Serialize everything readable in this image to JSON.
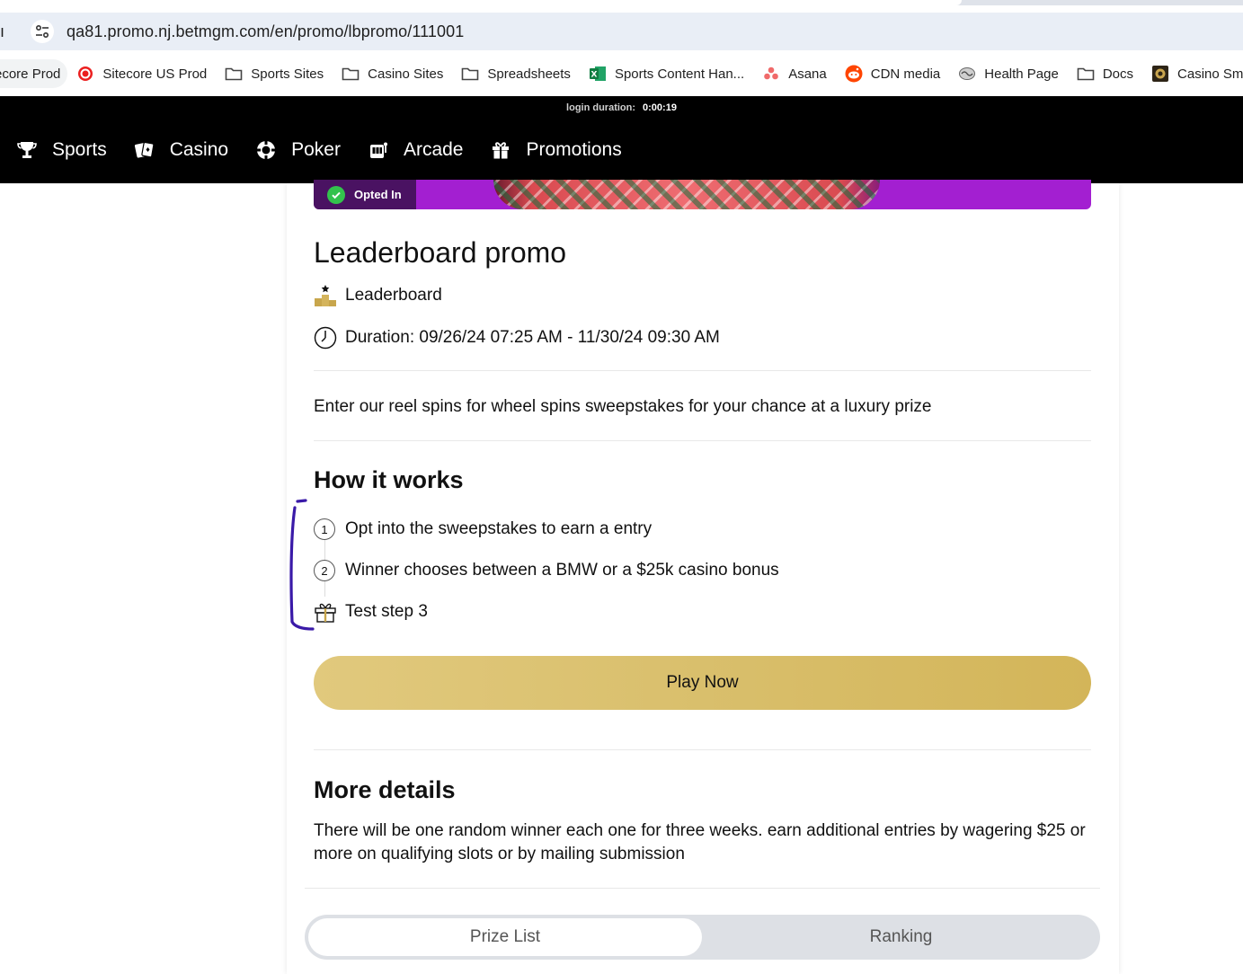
{
  "browser": {
    "left_stub": "ı",
    "url": "qa81.promo.nj.betmgm.com/en/promo/lbpromo/111001",
    "bookmarks": [
      {
        "label": "ecore Prod",
        "icon": "none"
      },
      {
        "label": "Sitecore US Prod",
        "icon": "sitecore-icon"
      },
      {
        "label": "Sports Sites",
        "icon": "folder-icon"
      },
      {
        "label": "Casino Sites",
        "icon": "folder-icon"
      },
      {
        "label": "Spreadsheets",
        "icon": "folder-icon"
      },
      {
        "label": "Sports Content Han...",
        "icon": "excel-icon"
      },
      {
        "label": "Asana",
        "icon": "asana-icon"
      },
      {
        "label": "CDN media",
        "icon": "reddit-icon"
      },
      {
        "label": "Health Page",
        "icon": "health-page-icon"
      },
      {
        "label": "Docs",
        "icon": "folder-icon"
      },
      {
        "label": "Casino Smart",
        "icon": "casino-smart-icon"
      }
    ]
  },
  "header": {
    "login_duration_label": "login duration:",
    "login_duration_value": "0:00:19",
    "nav": [
      {
        "label": "Sports",
        "icon": "trophy-icon"
      },
      {
        "label": "Casino",
        "icon": "cards-icon"
      },
      {
        "label": "Poker",
        "icon": "poker-chip-icon"
      },
      {
        "label": "Arcade",
        "icon": "arcade-icon"
      },
      {
        "label": "Promotions",
        "icon": "gift-icon"
      }
    ]
  },
  "promo": {
    "badge": "Opted In",
    "title": "Leaderboard promo",
    "type_label": "Leaderboard",
    "duration": "Duration: 09/26/24 07:25 AM - 11/30/24 09:30 AM",
    "description": "Enter our reel spins for wheel spins sweepstakes for your chance at a luxury prize",
    "how_it_works_title": "How it works",
    "steps": [
      {
        "marker": "1",
        "text": "Opt into the sweepstakes to earn a entry"
      },
      {
        "marker": "2",
        "text": "Winner chooses between a BMW or a $25k casino bonus"
      },
      {
        "marker": "gift",
        "text": "Test step 3"
      }
    ],
    "cta": "Play Now",
    "more_details_title": "More details",
    "more_details_text": "There will be one random winner each one for three weeks. earn additional entries by wagering $25 or more on qualifying slots or by mailing submission",
    "tabs": [
      {
        "label": "Prize List",
        "active": true
      },
      {
        "label": "Ranking",
        "active": false
      }
    ]
  },
  "colors": {
    "header_bg": "#000000",
    "banner_purple": "#a31fd1",
    "cta_gold": "#d9bf6c",
    "pen_mark": "#3a1aa8"
  }
}
